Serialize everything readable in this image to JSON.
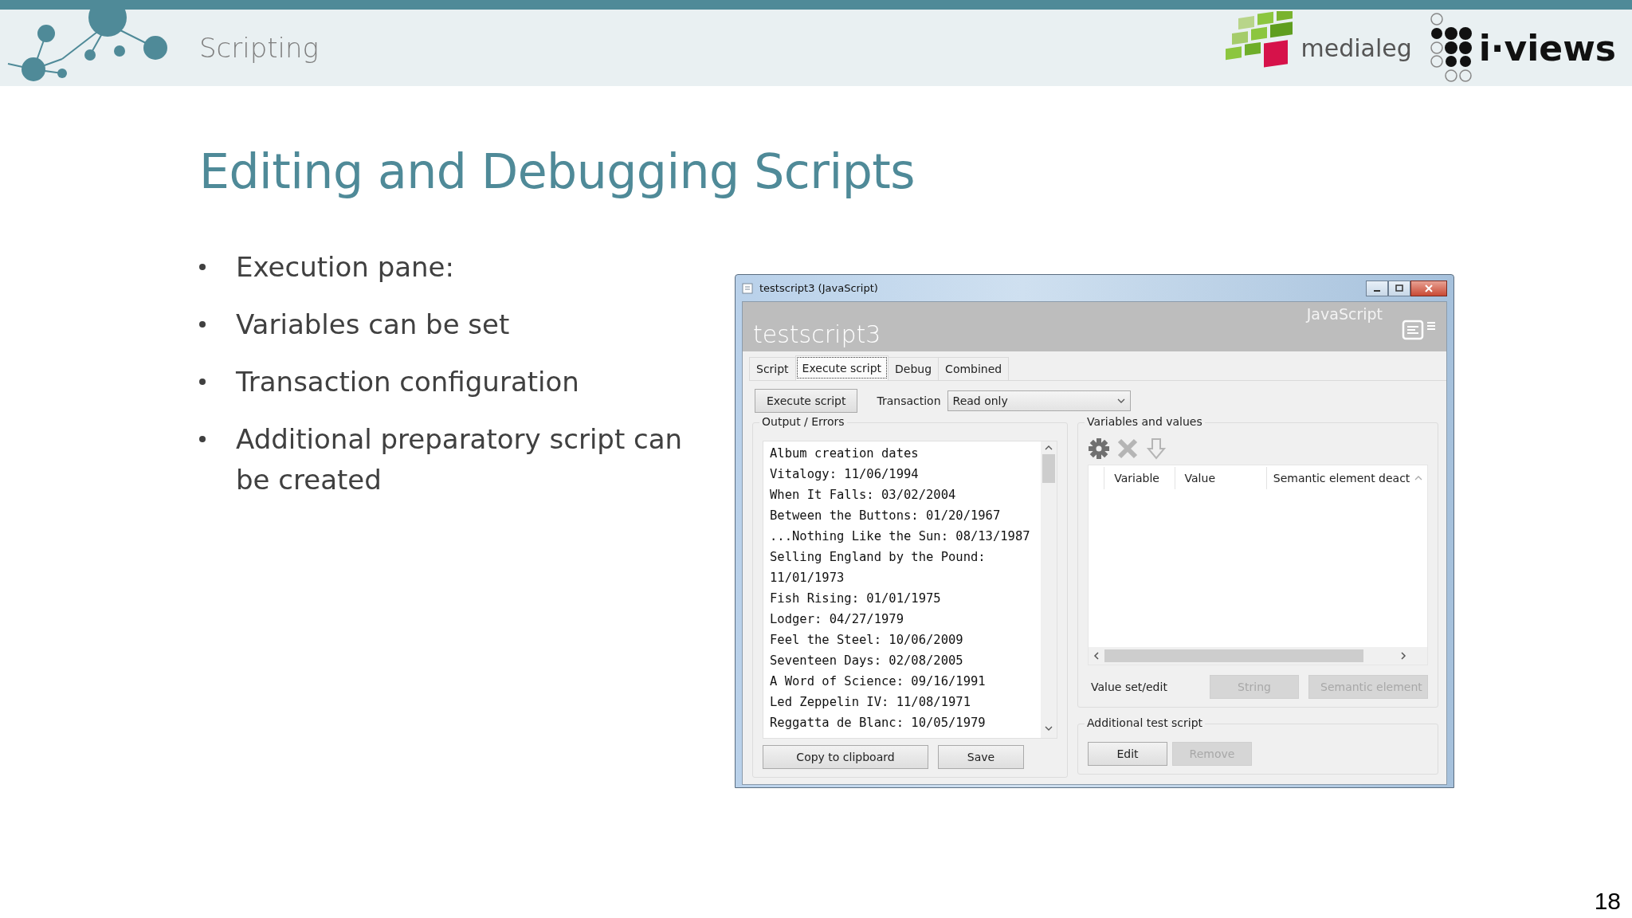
{
  "header": {
    "title": "Scripting",
    "logos": [
      {
        "kind": "medialeg",
        "text": "medialeg"
      },
      {
        "kind": "iviews",
        "text": "i·views"
      }
    ]
  },
  "slide": {
    "title": "Editing and Debugging Scripts",
    "bullets": [
      "Execution pane:",
      "Variables can be set",
      "Transaction configuration",
      "Additional preparatory script can be created"
    ],
    "page_number": "18"
  },
  "window": {
    "title": "testscript3 (JavaScript)",
    "heading": "testscript3",
    "language": "JavaScript",
    "tabs": [
      {
        "label": "Script",
        "selected": false
      },
      {
        "label": "Execute script",
        "selected": true
      },
      {
        "label": "Debug",
        "selected": false
      },
      {
        "label": "Combined",
        "selected": false
      }
    ],
    "execute_button": "Execute script",
    "transaction": {
      "label": "Transaction",
      "value": "Read only"
    },
    "output": {
      "label": "Output / Errors",
      "lines": [
        "Album creation dates",
        "Vitalogy: 11/06/1994",
        "When It Falls: 03/02/2004",
        "Between the Buttons: 01/20/1967",
        "...Nothing Like the Sun: 08/13/1987",
        "Selling England by the Pound:",
        "11/01/1973",
        "Fish Rising: 01/01/1975",
        "Lodger: 04/27/1979",
        "Feel the Steel: 10/06/2009",
        "Seventeen Days: 02/08/2005",
        "A Word of Science: 09/16/1991",
        "Led Zeppelin IV: 11/08/1971",
        "Reggatta de Blanc: 10/05/1979"
      ],
      "buttons": [
        {
          "label": "Copy to clipboard",
          "disabled": false
        },
        {
          "label": "Save",
          "disabled": false
        }
      ]
    },
    "variables": {
      "label": "Variables and values",
      "tools": [
        {
          "kind": "gear",
          "disabled": false
        },
        {
          "kind": "delete",
          "disabled": true
        },
        {
          "kind": "import",
          "disabled": true
        }
      ],
      "columns": [
        "Variable",
        "Value",
        "Semantic element deact"
      ],
      "edit_label": "Value set/edit",
      "buttons": [
        {
          "label": "String",
          "disabled": true
        },
        {
          "label": "Semantic element",
          "disabled": true
        }
      ]
    },
    "additional": {
      "label": "Additional test script",
      "buttons": [
        {
          "label": "Edit",
          "disabled": false
        },
        {
          "label": "Remove",
          "disabled": true
        }
      ]
    }
  }
}
